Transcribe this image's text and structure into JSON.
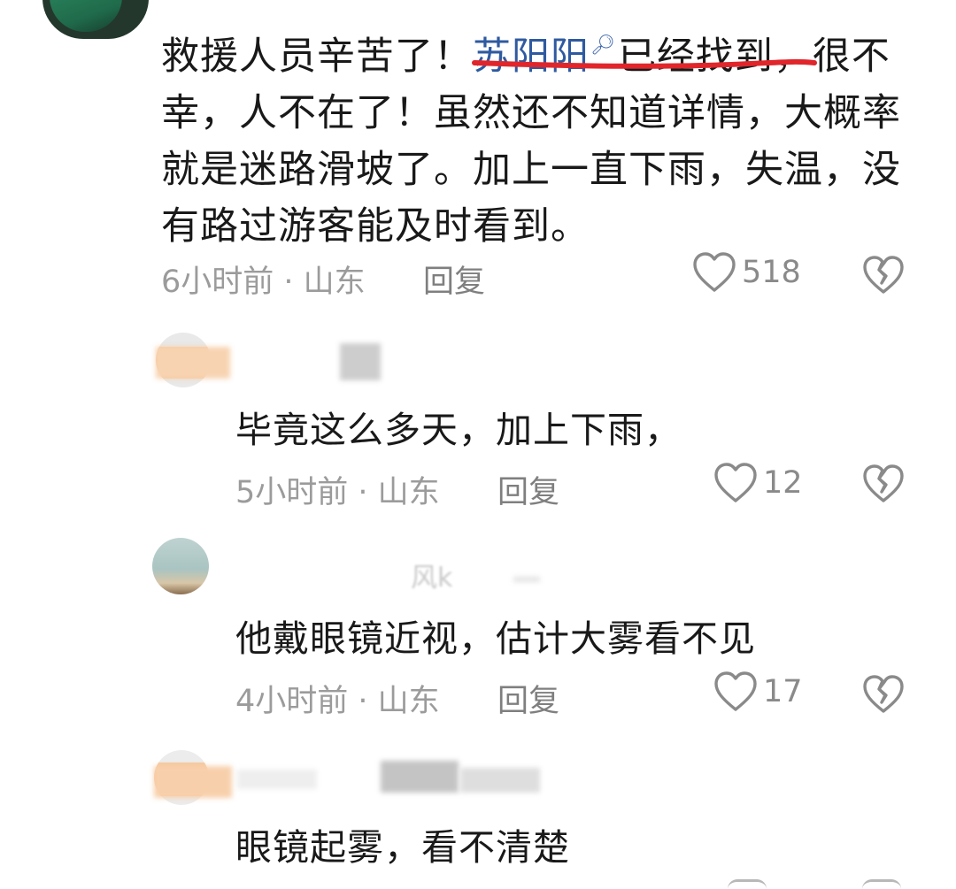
{
  "main_comment": {
    "text_before": "救援人员辛苦了！",
    "link": "苏阳阳",
    "text_after": "已经找到，很不幸，人不在了！虽然还不知道详情，大概率就是迷路滑坡了。加上一直下雨，失温，没有路过游客能及时看到。",
    "time": "6小时前",
    "location": "山东",
    "reply_label": "回复",
    "likes": "518"
  },
  "replies": [
    {
      "text": "毕竟这么多天，加上下雨，",
      "time": "5小时前",
      "location": "山东",
      "reply_label": "回复",
      "likes": "12"
    },
    {
      "partial_name": "风k",
      "text": "他戴眼镜近视，估计大雾看不见",
      "time": "4小时前",
      "location": "山东",
      "reply_label": "回复",
      "likes": "17"
    },
    {
      "text": "眼镜起雾，看不清楚"
    }
  ],
  "meta_separator": " · ",
  "colors": {
    "link": "#2f5aa0",
    "underline_annotation": "#e0262b",
    "meta_text": "#9b9b9b"
  },
  "icons": [
    "search-icon",
    "heart-icon",
    "broken-heart-icon"
  ]
}
